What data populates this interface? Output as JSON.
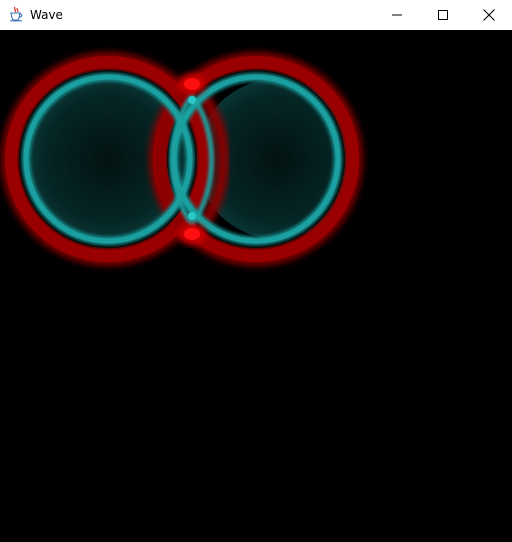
{
  "window": {
    "title": "Wave",
    "icon": "java-coffee-cup-icon",
    "controls": {
      "minimize": "minimize-icon",
      "maximize": "maximize-icon",
      "close": "close-icon"
    }
  },
  "visualization": {
    "description_colors": {
      "background": "#000000",
      "outer_ring": "#b00000",
      "inner_ring": "#1a9a9a",
      "interior_glow": "#062626"
    }
  }
}
